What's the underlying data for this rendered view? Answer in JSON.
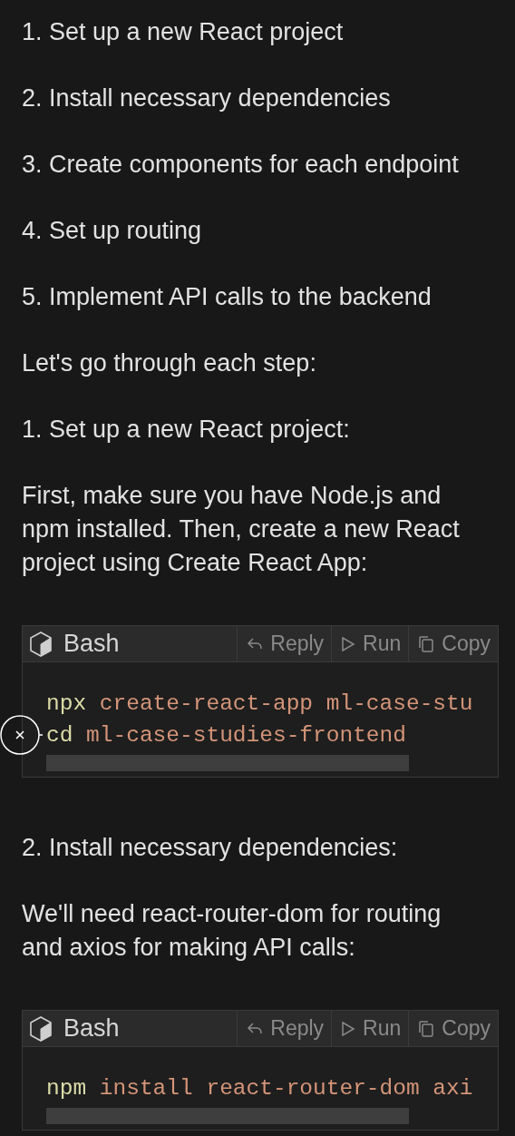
{
  "blocks": [
    {
      "kind": "paragraph",
      "text": "1. Set up a new React project"
    },
    {
      "kind": "paragraph",
      "text": "2. Install necessary dependencies"
    },
    {
      "kind": "paragraph",
      "text": "3. Create components for each endpoint"
    },
    {
      "kind": "paragraph",
      "text": "4. Set up routing"
    },
    {
      "kind": "paragraph",
      "text": "5. Implement API calls to the backend"
    },
    {
      "kind": "paragraph",
      "text": "Let's go through each step:"
    },
    {
      "kind": "paragraph",
      "text": "1. Set up a new React project:"
    },
    {
      "kind": "paragraph",
      "text": "First, make sure you have Node.js and npm installed. Then, create a new React project using Create React App:"
    },
    {
      "kind": "code",
      "language": "Bash",
      "actions": [
        "Reply",
        "Run",
        "Copy"
      ],
      "pointer_overlay": true,
      "lines": [
        {
          "command": "npx",
          "args": "create-react-app ml-case-stu"
        },
        {
          "command": "cd",
          "args": "ml-case-studies-frontend"
        }
      ]
    },
    {
      "kind": "paragraph",
      "text": "2. Install necessary dependencies:"
    },
    {
      "kind": "paragraph",
      "text": "We'll need react-router-dom for routing and axios for making API calls:"
    },
    {
      "kind": "code",
      "language": "Bash",
      "actions": [
        "Reply",
        "Run",
        "Copy"
      ],
      "lines": [
        {
          "command": "npm",
          "args": "install react-router-dom axi"
        }
      ]
    }
  ]
}
